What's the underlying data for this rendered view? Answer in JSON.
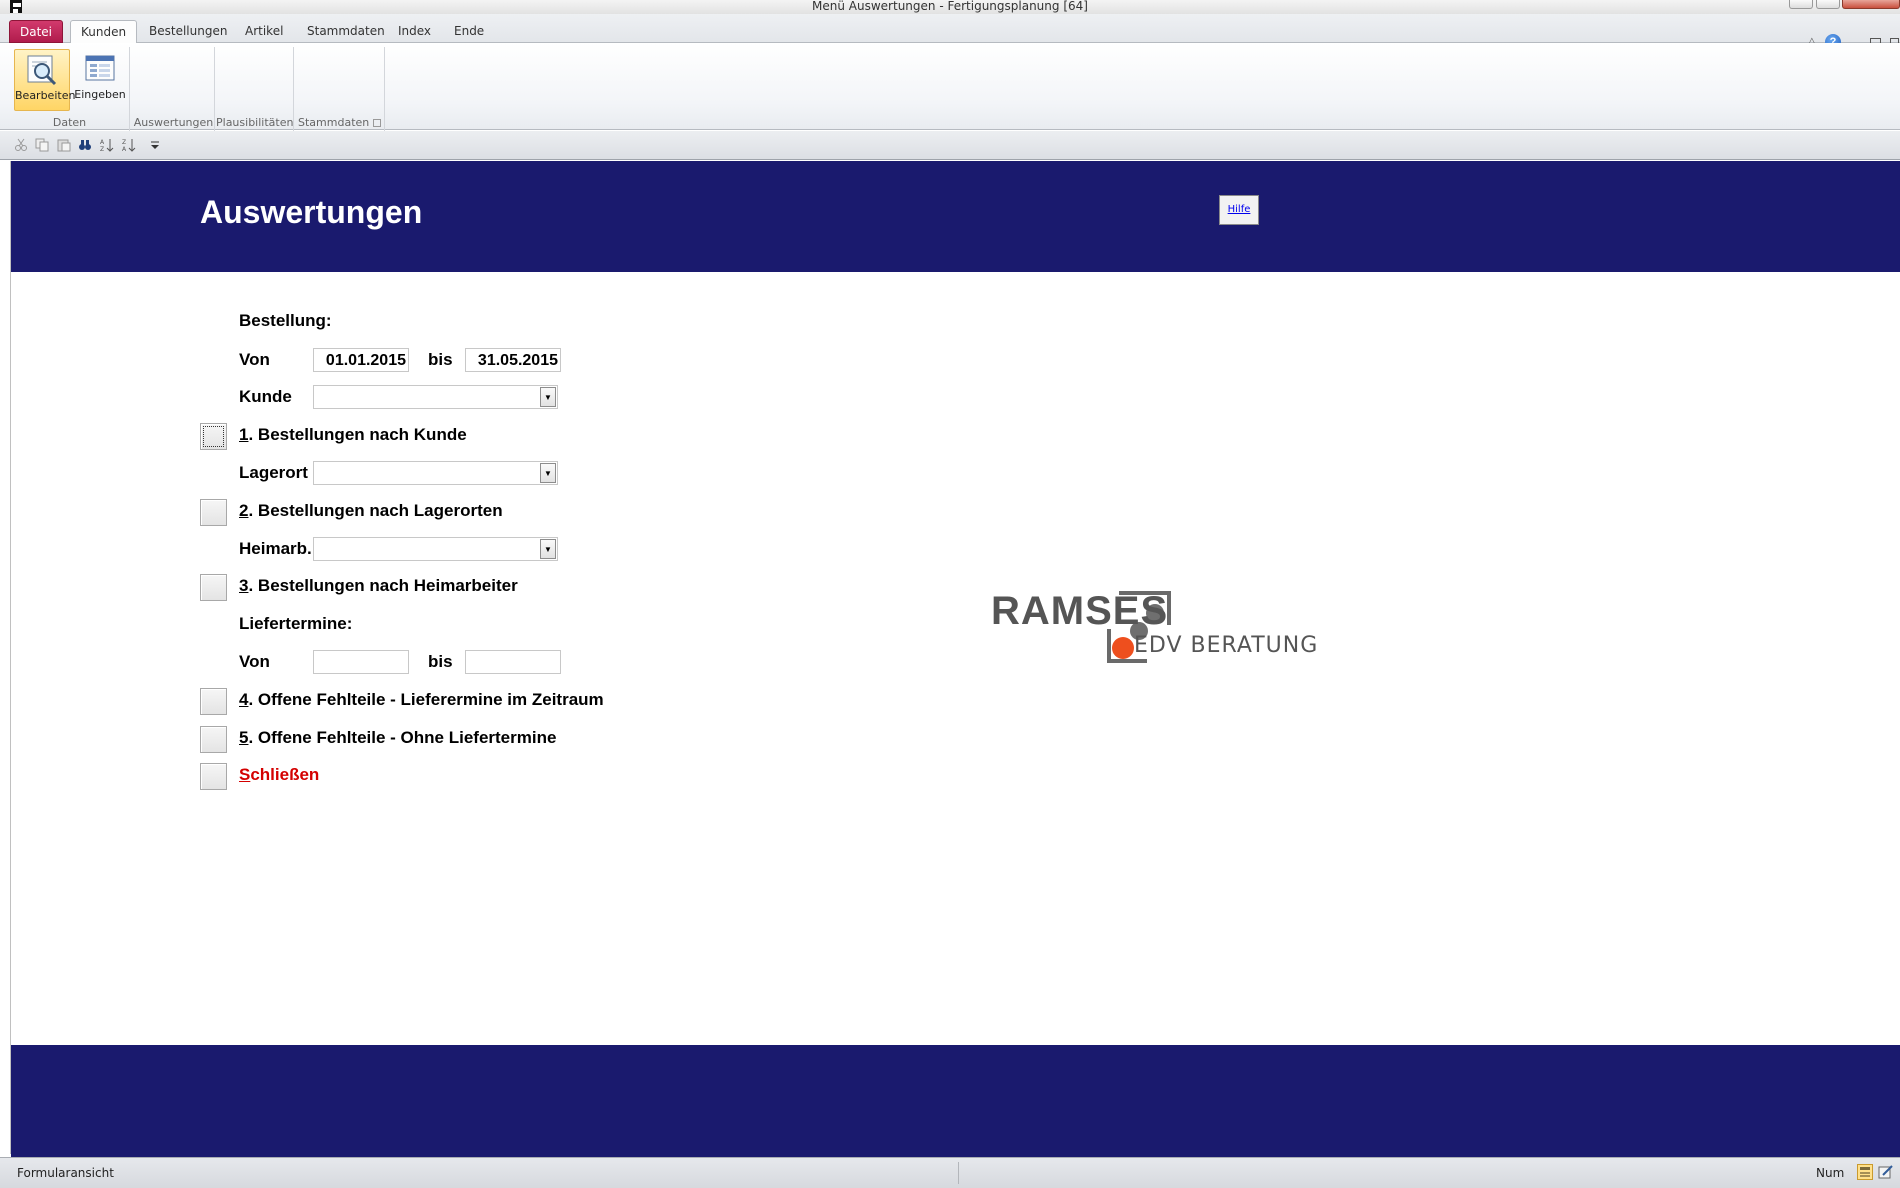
{
  "window": {
    "title": "Menü Auswertungen  -  Fertigungsplanung [64]"
  },
  "ribbon_tabs": [
    {
      "label": "Datei"
    },
    {
      "label": "Kunden"
    },
    {
      "label": "Bestellungen"
    },
    {
      "label": "Artikel"
    },
    {
      "label": "Stammdaten"
    },
    {
      "label": "Index"
    },
    {
      "label": "Ende"
    }
  ],
  "ribbon": {
    "group_daten": "Daten",
    "group_auswertungen": "Auswertungen",
    "group_plausibilitaeten": "Plausibilitäten",
    "group_stammdaten": "Stammdaten",
    "btn_bearbeiten": "Bearbeiten",
    "btn_eingeben": "Eingeben"
  },
  "form": {
    "title": "Auswertungen",
    "help_button": "Hilfe",
    "bestellung_heading": "Bestellung:",
    "von_label": "Von",
    "bis_label": "bis",
    "von_date": "01.01.2015",
    "bis_date": "31.05.2015",
    "kunde_label": "Kunde",
    "kunde_value": "",
    "report1_key": "1",
    "report1_text": ". Bestellungen nach Kunde",
    "lagerort_label": "Lagerort",
    "lagerort_value": "",
    "report2_key": "2",
    "report2_text": ". Bestellungen nach Lagerorten",
    "heimarb_label": "Heimarb.",
    "heimarb_value": "",
    "report3_key": "3",
    "report3_text": ". Bestellungen nach Heimarbeiter",
    "liefertermine_heading": "Liefertermine:",
    "lief_von_label": "Von",
    "lief_bis_label": "bis",
    "lief_von_value": "",
    "lief_bis_value": "",
    "report4_key": "4",
    "report4_text": ". Offene Fehlteile - Lieferermine im Zeitraum",
    "report5_key": "5",
    "report5_text": ". Offene Fehlteile - Ohne Liefertermine",
    "close_key": "S",
    "close_text": "chließen"
  },
  "logo": {
    "line1": "RAMSES",
    "line2": "EDV BERATUNG"
  },
  "statusbar": {
    "view_name": "Formularansicht",
    "num_indicator": "Num"
  },
  "colors": {
    "header_band": "#1a1a6e",
    "close_text": "#d40000",
    "logo_orange": "#ee4f1e",
    "logo_grey": "#555555"
  }
}
